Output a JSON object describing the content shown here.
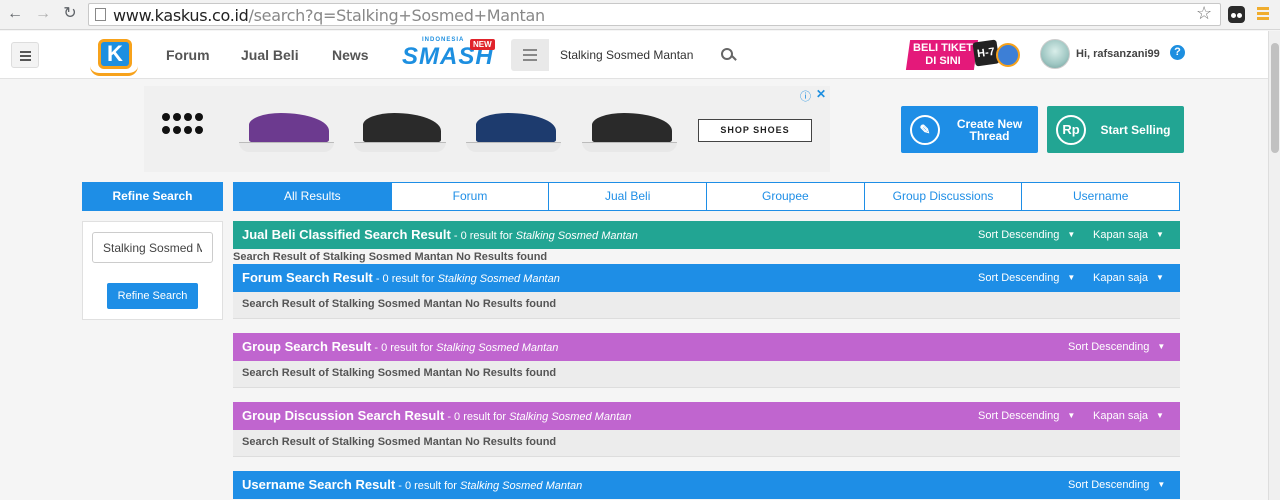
{
  "browser": {
    "url_host": "www.kaskus.co.id",
    "url_path": "/search?q=Stalking+Sosmed+Mantan"
  },
  "header": {
    "nav": [
      "Forum",
      "Jual Beli",
      "News"
    ],
    "smash_small": "INDONESIA",
    "smash_big": "SMASH",
    "smash_new": "NEW",
    "search_value": "Stalking Sosmed Mantan",
    "beli_banner": "BELI TIKET DI SINI",
    "beli_countdown": "H-7",
    "greeting": "Hi, rafsanzani99",
    "help": "?"
  },
  "ad": {
    "shop_button": "SHOP SHOES",
    "shoe_colors": [
      "#6c3a8f",
      "#2a2a2a",
      "#1d3b6e",
      "#2a2a2a"
    ]
  },
  "actions": {
    "create_thread": "Create New Thread",
    "start_selling": "Start Selling",
    "rp_icon": "Rp"
  },
  "sidebar": {
    "title": "Refine Search",
    "input_value": "Stalking Sosmed Mantan",
    "button": "Refine Search"
  },
  "tabs": [
    "All Results",
    "Forum",
    "Jual Beli",
    "Groupee",
    "Group Discussions",
    "Username"
  ],
  "sort_label": "Sort Descending",
  "time_label": "Kapan saja",
  "results": [
    {
      "title": "Jual Beli Classified Search Result",
      "count": " - 0 result for ",
      "query": "Stalking Sosmed Mantan",
      "message": "Search Result of Stalking Sosmed Mantan No Results found"
    },
    {
      "title": "Forum Search Result",
      "count": " - 0 result for ",
      "query": "Stalking Sosmed Mantan",
      "message": "Search Result of Stalking Sosmed Mantan No Results found"
    },
    {
      "title": "Group Search Result",
      "count": " - 0 result for ",
      "query": "Stalking Sosmed Mantan",
      "message": "Search Result of Stalking Sosmed Mantan No Results found"
    },
    {
      "title": "Group Discussion Search Result",
      "count": " - 0 result for ",
      "query": "Stalking Sosmed Mantan",
      "message": "Search Result of Stalking Sosmed Mantan No Results found"
    },
    {
      "title": "Username Search Result",
      "count": " - 0 result for ",
      "query": "Stalking Sosmed Mantan"
    }
  ],
  "colors": {
    "teal": "#22a593",
    "blue": "#1e8ee6",
    "purple": "#c065cf"
  }
}
